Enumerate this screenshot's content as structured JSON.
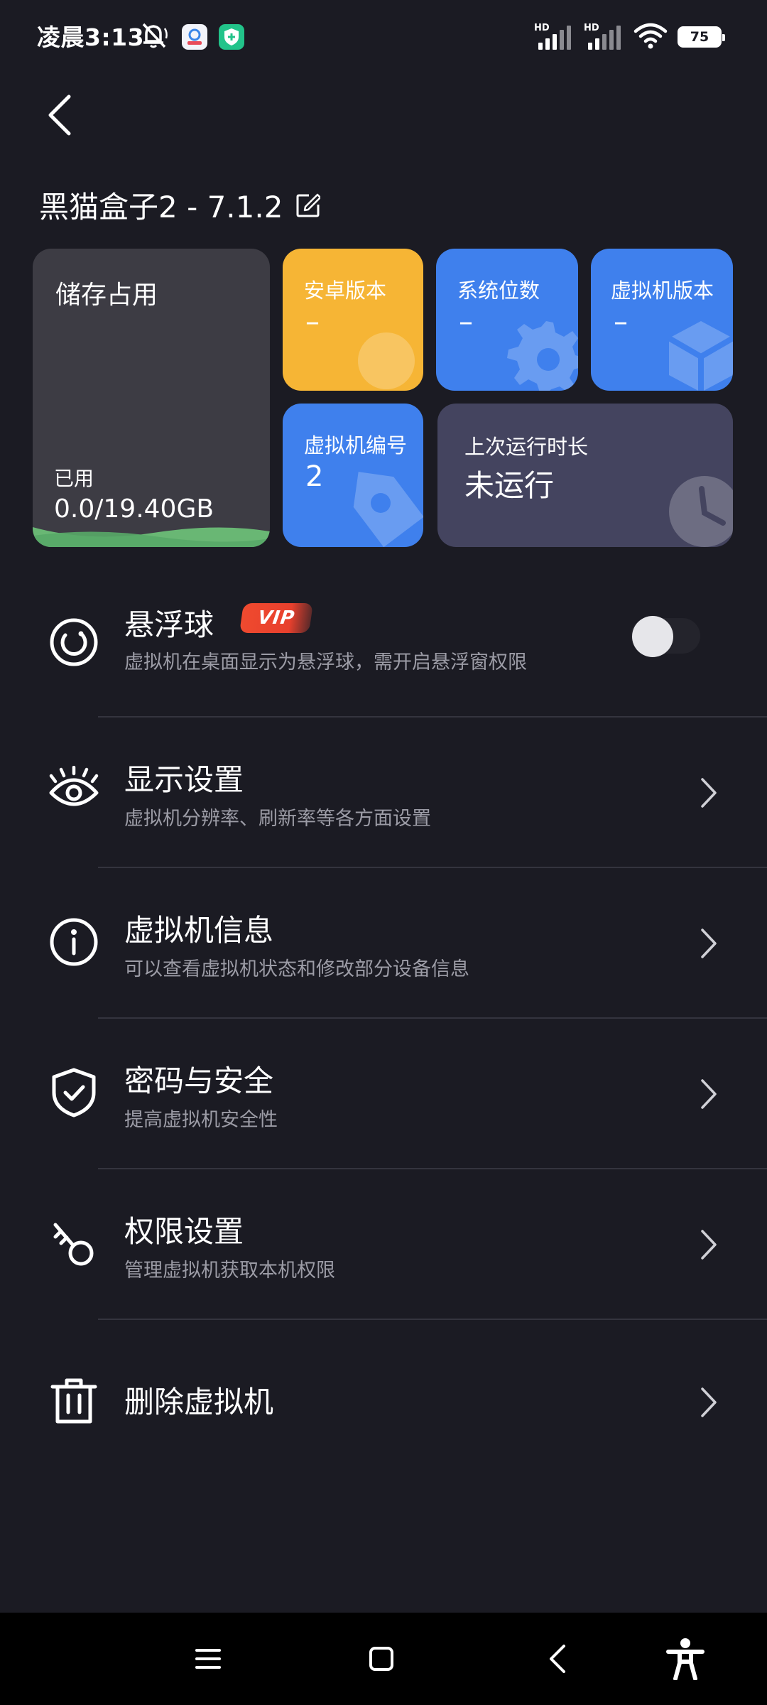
{
  "status_bar": {
    "time": "凌晨3:13",
    "hd_label_1": "HD",
    "hd_label_2": "HD",
    "battery": "75"
  },
  "header": {
    "title": "黑猫盒子2 - 7.1.2"
  },
  "cards": {
    "storage": {
      "label": "储存占用",
      "used_label": "已用",
      "value": "0.0/19.40GB"
    },
    "android_version": {
      "label": "安卓版本",
      "value": "–"
    },
    "system_bits": {
      "label": "系统位数",
      "value": "–"
    },
    "vm_version": {
      "label": "虚拟机版本",
      "value": "–"
    },
    "vm_number": {
      "label": "虚拟机编号",
      "value": "2"
    },
    "last_runtime": {
      "label": "上次运行时长",
      "value": "未运行"
    }
  },
  "list": [
    {
      "title": "悬浮球",
      "subtitle": "虚拟机在桌面显示为悬浮球，需开启悬浮窗权限",
      "badge": "VIP",
      "toggle_on": false
    },
    {
      "title": "显示设置",
      "subtitle": "虚拟机分辨率、刷新率等各方面设置"
    },
    {
      "title": "虚拟机信息",
      "subtitle": "可以查看虚拟机状态和修改部分设备信息"
    },
    {
      "title": "密码与安全",
      "subtitle": "提高虚拟机安全性"
    },
    {
      "title": "权限设置",
      "subtitle": "管理虚拟机获取本机权限"
    },
    {
      "title": "删除虚拟机"
    }
  ],
  "colors": {
    "background": "#1b1b23",
    "storage_card": "#3d3c44",
    "android_card": "#f6b535",
    "blue_card": "#3f80ed",
    "runtime_card": "#44445f",
    "vip_badge": "#ef4a2f",
    "storage_wave": "#6ec47a"
  },
  "icons": {
    "back": "back-arrow-icon",
    "edit": "edit-icon",
    "float_ball": "float-ball-icon",
    "display": "eye-icon",
    "info": "info-icon",
    "security": "shield-check-icon",
    "permission": "key-icon",
    "delete": "trash-icon",
    "chevron": "chevron-right-icon",
    "nav_menu": "menu-icon",
    "nav_home": "home-icon",
    "nav_back": "back-icon",
    "nav_accessibility": "accessibility-icon"
  }
}
